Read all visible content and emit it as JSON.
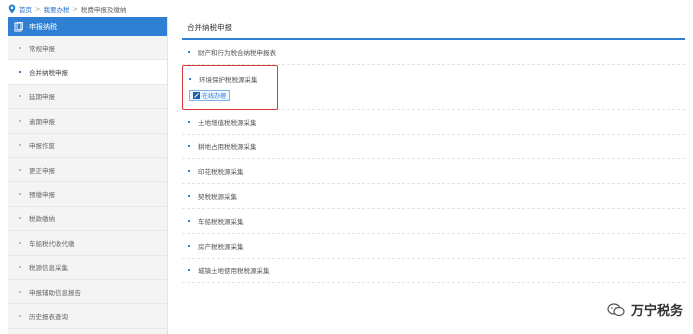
{
  "breadcrumb": {
    "home": "首页",
    "level2": "我要办税",
    "level3": "税费申报及缴纳"
  },
  "sidebar": {
    "header": "申报纳税",
    "items": [
      {
        "label": "常规申报",
        "active": false
      },
      {
        "label": "合并纳税申报",
        "active": true
      },
      {
        "label": "延期申报",
        "active": false
      },
      {
        "label": "逾期申报",
        "active": false
      },
      {
        "label": "申报作废",
        "active": false
      },
      {
        "label": "更正申报",
        "active": false
      },
      {
        "label": "预缴申报",
        "active": false
      },
      {
        "label": "税款缴纳",
        "active": false
      },
      {
        "label": "车船税代收代缴",
        "active": false
      },
      {
        "label": "税源信息采集",
        "active": false
      },
      {
        "label": "申报辅助信息报告",
        "active": false
      },
      {
        "label": "历史报表查询",
        "active": false
      }
    ]
  },
  "main": {
    "title": "合并纳税申报",
    "items": [
      {
        "label": "财产和行为税合纳税申报表"
      },
      {
        "label": "环境保护税税源采集",
        "button": "在线办理",
        "highlighted": true
      },
      {
        "label": "土地增值税税源采集"
      },
      {
        "label": "耕地占用税税源采集"
      },
      {
        "label": "印花税税源采集"
      },
      {
        "label": "契税税源采集"
      },
      {
        "label": "车船税税源采集"
      },
      {
        "label": "房产税税源采集"
      },
      {
        "label": "城镇土地使用税税源采集"
      }
    ]
  },
  "watermark": {
    "text": "万宁税务"
  },
  "colors": {
    "accent": "#2f7fd3",
    "highlight": "#d93a3a"
  }
}
